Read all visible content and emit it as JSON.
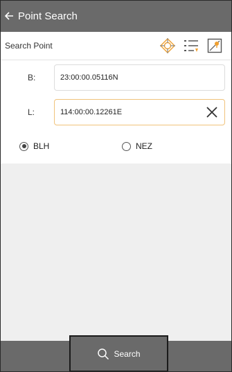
{
  "appbar": {
    "title": "Point Search"
  },
  "toolbar": {
    "title": "Search Point",
    "colors": {
      "accent": "#f0a030"
    }
  },
  "fields": [
    {
      "label": "B:",
      "value": "23:00:00.05116N"
    },
    {
      "label": "L:",
      "value": "114:00:00.12261E"
    }
  ],
  "radios": [
    {
      "label": "BLH",
      "selected": true
    },
    {
      "label": "NEZ",
      "selected": false
    }
  ],
  "search_button": {
    "label": "Search"
  },
  "icons": [
    "back-arrow-icon",
    "crosshair-location-icon",
    "list-icon",
    "map-point-icon",
    "close-icon",
    "search-icon"
  ]
}
